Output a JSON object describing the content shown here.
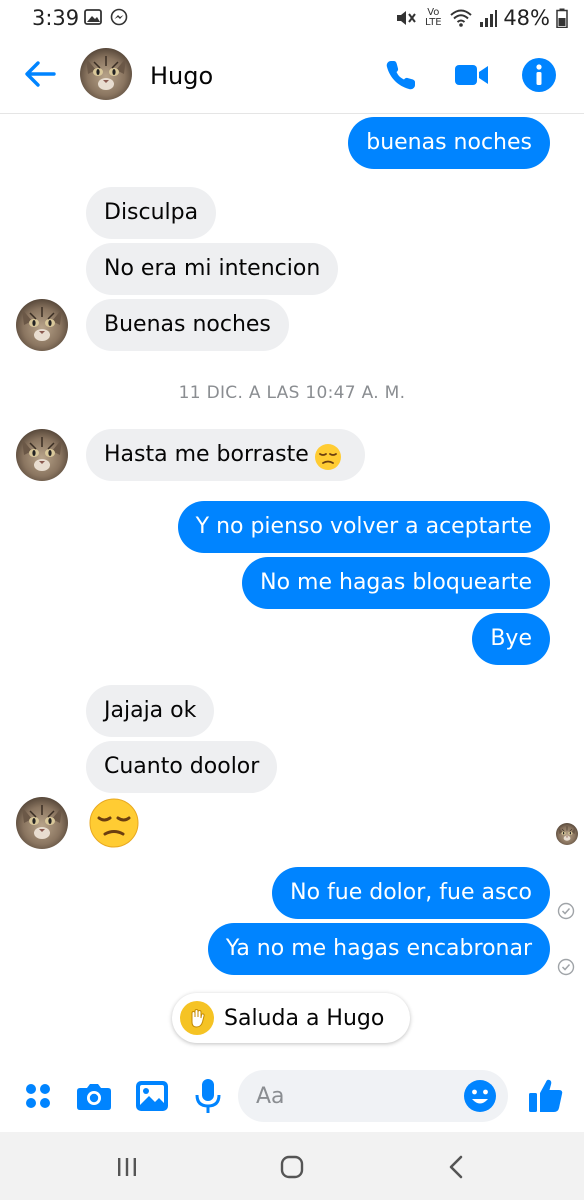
{
  "status_bar": {
    "time": "3:39",
    "battery": "48%",
    "network": "Vo LTE"
  },
  "header": {
    "contact_name": "Hugo",
    "icons": [
      "back-arrow-icon",
      "phone-icon",
      "video-camera-icon",
      "info-icon"
    ]
  },
  "conversation": {
    "messages_top": [
      {
        "from": "me",
        "text": "buenas noches"
      },
      {
        "from": "hugo",
        "text": "Disculpa"
      },
      {
        "from": "hugo",
        "text": "No era mi intencion"
      },
      {
        "from": "hugo",
        "text": "Buenas noches"
      }
    ],
    "timestamp": "11 DIC. A LAS 10:47 A. M.",
    "messages_bottom": [
      {
        "from": "hugo",
        "text": "Hasta me borraste"
      },
      {
        "from": "me",
        "text": "Y no pienso volver a aceptarte"
      },
      {
        "from": "me",
        "text": "No me hagas bloquearte"
      },
      {
        "from": "me",
        "text": "Bye"
      },
      {
        "from": "hugo",
        "text": "Jajaja ok"
      },
      {
        "from": "hugo",
        "text": "Cuanto doolor"
      },
      {
        "from": "hugo",
        "emoji": "pensive-face-icon"
      },
      {
        "from": "me",
        "text": "No fue dolor, fue asco"
      },
      {
        "from": "me",
        "text": "Ya no me hagas encabronar"
      }
    ],
    "wave_prompt": "Saluda a Hugo"
  },
  "composer": {
    "placeholder": "Aa",
    "icons": [
      "more-apps-icon",
      "camera-icon",
      "gallery-icon",
      "microphone-icon",
      "emoji-icon",
      "like-icon"
    ]
  },
  "colors": {
    "accent": "#0084ff",
    "incoming_bubble": "#eeeff1",
    "timestamp": "#8a8d91"
  }
}
